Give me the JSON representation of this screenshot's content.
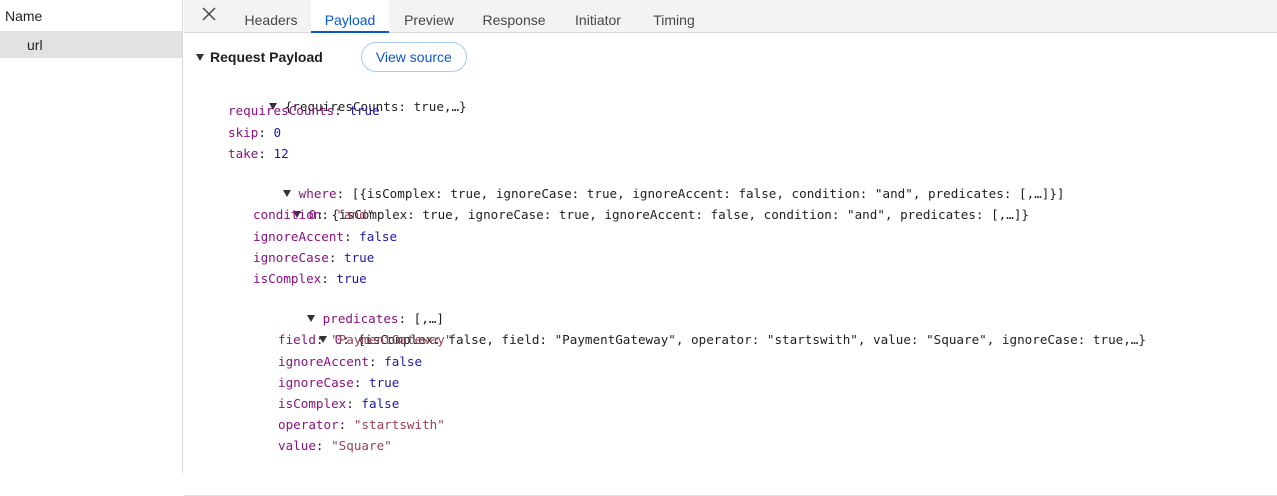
{
  "left": {
    "header": "Name",
    "rows": [
      "url"
    ]
  },
  "tabs": [
    "Headers",
    "Payload",
    "Preview",
    "Response",
    "Initiator",
    "Timing"
  ],
  "active_tab": "Payload",
  "section": {
    "title": "Request Payload",
    "view_source": "View source"
  },
  "tree": {
    "root_summary": "{requiresCounts: true,…}",
    "requiresCounts": {
      "key": "requiresCounts",
      "value": "true"
    },
    "skip": {
      "key": "skip",
      "value": "0"
    },
    "take": {
      "key": "take",
      "value": "12"
    },
    "where": {
      "key": "where",
      "summary": "[{isComplex: true, ignoreCase: true, ignoreAccent: false, condition: \"and\", predicates: [,…]}]",
      "item0": {
        "key": "0",
        "summary": "{isComplex: true, ignoreCase: true, ignoreAccent: false, condition: \"and\", predicates: [,…]}",
        "condition": {
          "key": "condition",
          "value": "\"and\""
        },
        "ignoreAccent": {
          "key": "ignoreAccent",
          "value": "false"
        },
        "ignoreCase": {
          "key": "ignoreCase",
          "value": "true"
        },
        "isComplex": {
          "key": "isComplex",
          "value": "true"
        },
        "predicates": {
          "key": "predicates",
          "summary": "[,…]",
          "item0": {
            "key": "0",
            "summary": "{isComplex: false, field: \"PaymentGateway\", operator: \"startswith\", value: \"Square\", ignoreCase: true,…}",
            "field": {
              "key": "field",
              "value": "\"PaymentGateway\""
            },
            "ignoreAccent": {
              "key": "ignoreAccent",
              "value": "false"
            },
            "ignoreCase": {
              "key": "ignoreCase",
              "value": "true"
            },
            "isComplex": {
              "key": "isComplex",
              "value": "false"
            },
            "operator": {
              "key": "operator",
              "value": "\"startswith\""
            },
            "value": {
              "key": "value",
              "value": "\"Square\""
            }
          }
        }
      }
    }
  },
  "colors": {
    "accent": "#0b57d0",
    "key": "#881280",
    "keyword": "#1a1aa6",
    "string": "#994055"
  }
}
